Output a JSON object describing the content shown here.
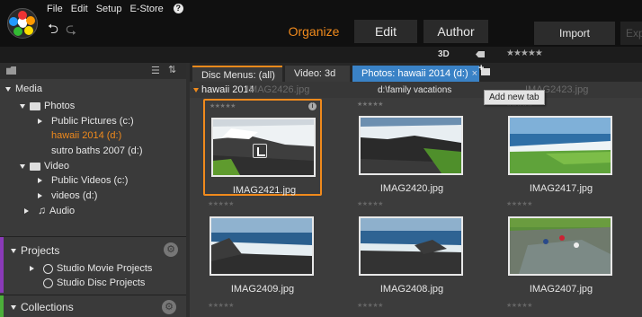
{
  "menu": {
    "items": [
      "File",
      "Edit",
      "Setup",
      "E-Store"
    ]
  },
  "undo_redo": {
    "undo": "⮌",
    "redo": "⮎"
  },
  "modes": {
    "organize": "Organize",
    "edit": "Edit",
    "author": "Author"
  },
  "header": {
    "import": "Import",
    "export": "Exp"
  },
  "toolbar": {
    "three_d": "3D",
    "rating": "★★★★★"
  },
  "sidebar": {
    "media": "Media",
    "photos": "Photos",
    "public_pictures": "Public Pictures (c:)",
    "hawaii": "hawaii 2014 (d:)",
    "sutro": "sutro baths 2007 (d:)",
    "video": "Video",
    "public_videos": "Public Videos (c:)",
    "videos_d": "videos (d:)",
    "audio": "Audio",
    "projects": "Projects",
    "movie_projects": "Studio Movie Projects",
    "disc_projects": "Studio Disc Projects",
    "collections": "Collections"
  },
  "library_tabs": {
    "disc_menus": "Disc Menus: (all)",
    "video": "Video: 3d",
    "photos": "Photos: hawaii 2014 (d:)",
    "close": "×"
  },
  "location": {
    "current": "hawaii 2014",
    "ghost_left": "IMAG2426.jpg",
    "middle": "d:\\family vacations",
    "ghost_right": "IMAG2423.jpg"
  },
  "tooltip": "Add new tab",
  "stars": "★★★★★",
  "thumbs": [
    {
      "name": "IMAG2421.jpg"
    },
    {
      "name": "IMAG2420.jpg"
    },
    {
      "name": "IMAG2417.jpg"
    },
    {
      "name": "IMAG2409.jpg"
    },
    {
      "name": "IMAG2408.jpg"
    },
    {
      "name": "IMAG2407.jpg"
    }
  ],
  "colors": {
    "accent": "#f08a1c",
    "active_tab": "#3a82c6",
    "projects_stripe": "#8a3ab8",
    "collections_stripe": "#4cae3a"
  }
}
